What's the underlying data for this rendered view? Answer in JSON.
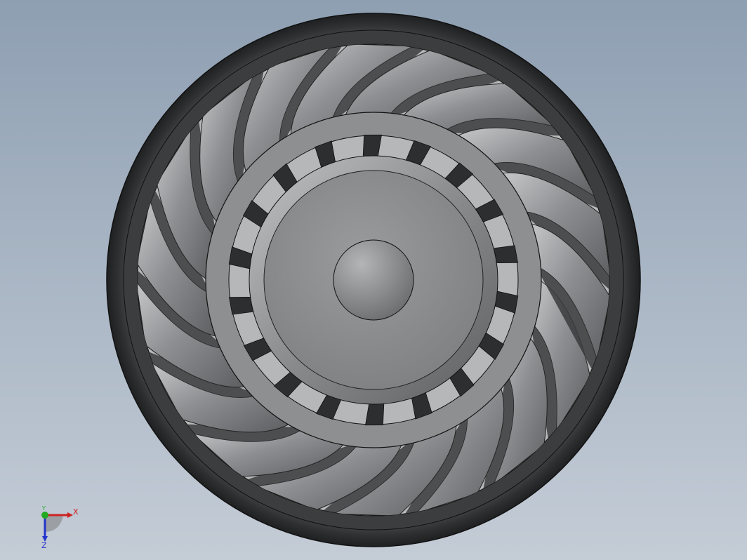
{
  "scene": {
    "model": "axial-fan-impeller",
    "view": "front",
    "blade_count": 18,
    "spoke_count": 18,
    "colors": {
      "background_top": "#8e9fb2",
      "background_bottom": "#c4ccd6",
      "rim": "#3a3b3c",
      "blade": "#8f9194",
      "hub": "#8c8d8f",
      "spoke": "#2d2e30"
    }
  },
  "triad": {
    "x_label": "X",
    "y_label": "Y",
    "z_label": "Z",
    "colors": {
      "x": "#cc2222",
      "y": "#22aa22",
      "z": "#2233cc"
    }
  }
}
